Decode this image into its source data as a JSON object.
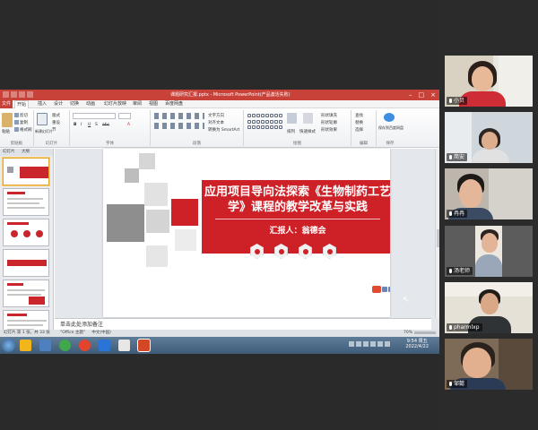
{
  "window": {
    "title": "课题研究汇报.pptx - Microsoft PowerPoint(产品激活失败)",
    "controls": [
      "–",
      "□",
      "×"
    ]
  },
  "ribbon": {
    "tabs": [
      "文件",
      "开始",
      "插入",
      "设计",
      "切换",
      "动画",
      "幻灯片放映",
      "审阅",
      "视图",
      "百度网盘"
    ],
    "active_tab": "开始",
    "groups": [
      {
        "label": "剪贴板",
        "buttons": [
          "粘贴",
          "剪切",
          "复制",
          "格式刷"
        ]
      },
      {
        "label": "幻灯片",
        "buttons": [
          "新建幻灯片",
          "版式",
          "重设",
          "节"
        ]
      },
      {
        "label": "字体",
        "buttons": [
          "B",
          "I",
          "U",
          "S",
          "abc",
          "A"
        ]
      },
      {
        "label": "段落",
        "buttons": [
          "文字方向",
          "对齐文本",
          "转换为 SmartArt"
        ]
      },
      {
        "label": "绘图",
        "buttons": [
          "排列",
          "快速样式",
          "形状填充",
          "形状轮廓",
          "形状效果"
        ]
      },
      {
        "label": "编辑",
        "buttons": [
          "查找",
          "替换",
          "选择"
        ]
      },
      {
        "label": "保存",
        "buttons": [
          "保存到百度网盘"
        ]
      }
    ]
  },
  "slide_panel": {
    "tabs": [
      "幻灯片",
      "大纲"
    ],
    "numbers": [
      "1",
      "2",
      "3",
      "4",
      "5",
      "6"
    ]
  },
  "slide": {
    "title": "应用项目导向法探索《生物制药工艺学》课程的教学改革与实践",
    "presenter": "汇报人：翁德会"
  },
  "notes": {
    "placeholder": "单击此处添加备注"
  },
  "status_bar": {
    "slide_info": "幻灯片 第 1 张，共 33 张",
    "theme": "\"Office 主题\"",
    "language": "中文(中国)",
    "zoom": "70%"
  },
  "taskbar": {
    "time": "9:54 周五",
    "date": "2022/4/22"
  },
  "participants": [
    {
      "name": "小贝",
      "speaking": false
    },
    {
      "name": "简安",
      "speaking": false
    },
    {
      "name": "冉冉",
      "speaking": false
    },
    {
      "name": "汤老师",
      "speaking": false
    },
    {
      "name": "pharmlxp",
      "speaking": false
    },
    {
      "name": "邹懿",
      "speaking": true
    }
  ],
  "colors": {
    "accent_red": "#cd2027",
    "office_red": "#c8423a",
    "speaking_border": "#29d36b",
    "background": "#262626"
  }
}
